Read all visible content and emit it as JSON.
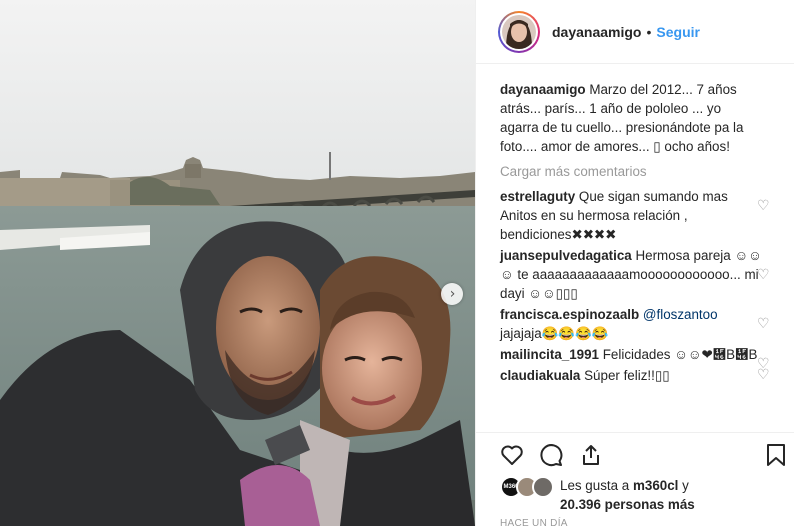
{
  "post": {
    "username": "dayanaamigo",
    "follow_label": "Seguir",
    "dot": "•",
    "caption": "Marzo del 2012... 7 años atrás... parís... 1 año de pololeo ... yo agarra de tu cuello... presionándote pa la foto.... amor de amores... ▯ ocho años!",
    "load_more": "Cargar más comentarios"
  },
  "comments": [
    {
      "user": "estrellaguty",
      "text": "Que sigan sumando mas Anitos en su hermosa relación , bendiciones✖✖✖✖"
    },
    {
      "user": "juansepulvedagatica",
      "text": "Hermosa pareja ☺☺☺ te aaaaaaaaaaaaamoooooooooooo... mi dayi ☺☺▯▯▯"
    },
    {
      "user": "francisca.espinozaalb",
      "mention": "@floszantoo",
      "text": "jajajaja😂😂😂😂"
    },
    {
      "user": "mailincita_1991",
      "text": "Felicidades ☺☺❤὆B὆B"
    },
    {
      "user": "claudiakuala",
      "text": "Súper feliz!!▯▯"
    }
  ],
  "likes": {
    "prefix": "Les gusta a",
    "user": "m360cl",
    "suffix": "y",
    "count_text": "20.396 personas más",
    "badge": "M360"
  },
  "date": "HACE UN DÍA",
  "colors": {
    "link": "#3897f0",
    "mention": "#003569",
    "muted": "#999999"
  }
}
